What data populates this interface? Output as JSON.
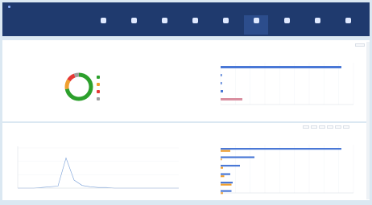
{
  "topnav": {
    "title": "",
    "context_lines": [
      "",
      "",
      ""
    ],
    "group_labels": [
      "",
      ""
    ],
    "nav_items": [
      {
        "label": "",
        "icon": "home-icon"
      },
      {
        "label": "",
        "icon": "server-icon"
      },
      {
        "label": "",
        "icon": "grid-icon"
      },
      {
        "label": "",
        "icon": "database-icon"
      },
      {
        "label": "",
        "icon": "network-icon"
      },
      {
        "label": "",
        "icon": "chart-icon"
      },
      {
        "label": "",
        "icon": "cloud-icon"
      },
      {
        "label": "",
        "icon": "settings-icon"
      },
      {
        "label": "",
        "icon": "user-icon"
      }
    ],
    "active_index": 5
  },
  "top_section": {
    "label": "",
    "left_panel_title": "",
    "donut": {
      "center_text": [
        "",
        ""
      ],
      "segments": [
        {
          "label": "",
          "value": 0.72,
          "color": "#2ca02c"
        },
        {
          "label": "",
          "value": 0.12,
          "color": "#f0a030"
        },
        {
          "label": "",
          "value": 0.1,
          "color": "#e53935"
        },
        {
          "label": "",
          "value": 0.06,
          "color": "#9e9e9e"
        }
      ],
      "legend_values": [
        "",
        "",
        "",
        ""
      ]
    },
    "right_panel_title": ""
  },
  "bottom_section": {
    "label": "",
    "toolbar_buttons": [
      "",
      "",
      "",
      "",
      "",
      ""
    ],
    "left_panel_title": "",
    "right_panel_title": ""
  },
  "colors": {
    "nav_bg": "#1f3a6e",
    "bar_blue": "#4a78d6",
    "bar_orange": "#f0a030",
    "bar_pink": "#d98fa0",
    "line_blue": "#7aa0d8"
  },
  "chart_data": [
    {
      "type": "bar",
      "orientation": "horizontal",
      "categories": [
        "",
        "",
        "",
        "",
        ""
      ],
      "values": [
        100,
        1,
        1,
        2,
        18
      ],
      "xlim": [
        0,
        110
      ]
    },
    {
      "type": "line",
      "x": [
        0,
        1,
        2,
        3,
        4,
        5,
        6,
        7,
        8,
        9,
        10,
        11,
        12,
        13,
        14,
        15,
        16,
        17,
        18,
        19,
        20
      ],
      "y": [
        0,
        0,
        0,
        1,
        2,
        3,
        45,
        12,
        4,
        2,
        1,
        1,
        0,
        0,
        0,
        0,
        0,
        0,
        0,
        0,
        0
      ],
      "ylim": [
        0,
        60
      ]
    },
    {
      "type": "bar",
      "orientation": "horizontal",
      "categories": [
        "",
        "",
        "",
        "",
        "",
        ""
      ],
      "series": [
        {
          "values": [
            100,
            28,
            16,
            8,
            10,
            9
          ]
        },
        {
          "values": [
            8,
            1,
            2,
            3,
            9,
            2
          ]
        }
      ],
      "xlim": [
        0,
        110
      ]
    }
  ]
}
